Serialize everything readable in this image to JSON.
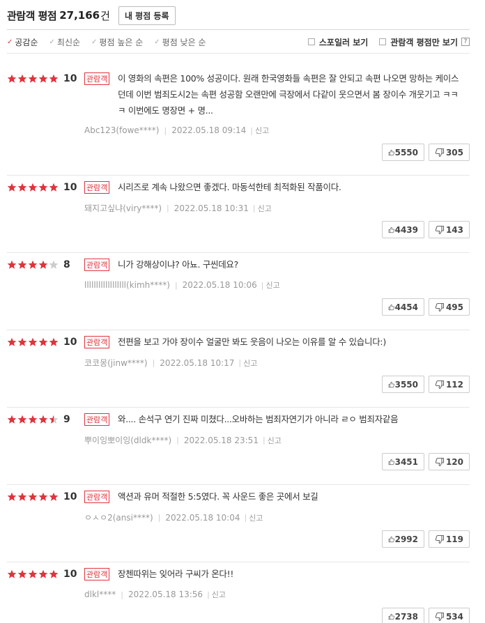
{
  "header": {
    "title": "관람객 평점",
    "count": "27,166",
    "unit": "건",
    "register_label": "내 평점 등록"
  },
  "sort": {
    "items": [
      {
        "label": "공감순",
        "active": true
      },
      {
        "label": "최신순",
        "active": false
      },
      {
        "label": "평점 높은 순",
        "active": false
      },
      {
        "label": "평점 낮은 순",
        "active": false
      }
    ],
    "spoiler_label": "스포일러 보기",
    "audience_only_label": "관람객 평점만 보기",
    "help_label": "?"
  },
  "colors": {
    "star": "#e0333c",
    "star_empty": "#cccccc",
    "badge": "#e0333c"
  },
  "reviews": [
    {
      "stars": 5,
      "score": "10",
      "badge": "관람객",
      "text": "이 영화의 속편은 100% 성공이다. 원래 한국영화들 속편은 잘 안되고 속편 나오면 망하는 케이스던데 이번 범죄도시2는 속편 성공함 오랜만에 극장에서 다같이 웃으면서 봄 장이수 개웃기고 ㅋㅋㅋ 이번에도 명장면 + 명...",
      "author": "Abc123(fowe****)",
      "date": "2022.05.18 09:14",
      "report": "신고",
      "likes": "5550",
      "dislikes": "305"
    },
    {
      "stars": 5,
      "score": "10",
      "badge": "관람객",
      "text": "시리즈로 계속 나왔으면 좋겠다. 마동석한테 최적화된 작품이다.",
      "author": "돼지고싶냐(viry****)",
      "date": "2022.05.18 10:31",
      "report": "신고",
      "likes": "4439",
      "dislikes": "143"
    },
    {
      "stars": 4,
      "score": "8",
      "badge": "관람객",
      "text": "니가 강해상이냐? 아뇨. 구씬데요?",
      "author": "llllllllllllllllll(kimh****)",
      "date": "2022.05.18 10:06",
      "report": "신고",
      "likes": "4454",
      "dislikes": "495"
    },
    {
      "stars": 5,
      "score": "10",
      "badge": "관람객",
      "text": "전편을 보고 가야 장이수 얼굴만 봐도 웃음이 나오는 이유를 알 수 있습니다:)",
      "author": "코코몽(jinw****)",
      "date": "2022.05.18 10:17",
      "report": "신고",
      "likes": "3550",
      "dislikes": "112"
    },
    {
      "stars": 4.5,
      "score": "9",
      "badge": "관람객",
      "text": "와.... 손석구 연기 진짜 미쳤다...오바하는 범죄자연기가 아니라 ㄹㅇ 범죄자같음",
      "author": "뿌이잉뽀이잉(dldk****)",
      "date": "2022.05.18 23:51",
      "report": "신고",
      "likes": "3451",
      "dislikes": "120"
    },
    {
      "stars": 5,
      "score": "10",
      "badge": "관람객",
      "text": "액션과 유머 적절한 5:5였다. 꼭 사운드 좋은 곳에서 보길",
      "author": "ㅇㅅㅇ2(ansi****)",
      "date": "2022.05.18 10:04",
      "report": "신고",
      "likes": "2992",
      "dislikes": "119"
    },
    {
      "stars": 5,
      "score": "10",
      "badge": "관람객",
      "text": "장첸따위는 잊어라 구씨가 온다!!",
      "author": "dlkl****",
      "date": "2022.05.18 13:56",
      "report": "신고",
      "likes": "2738",
      "dislikes": "534"
    }
  ]
}
